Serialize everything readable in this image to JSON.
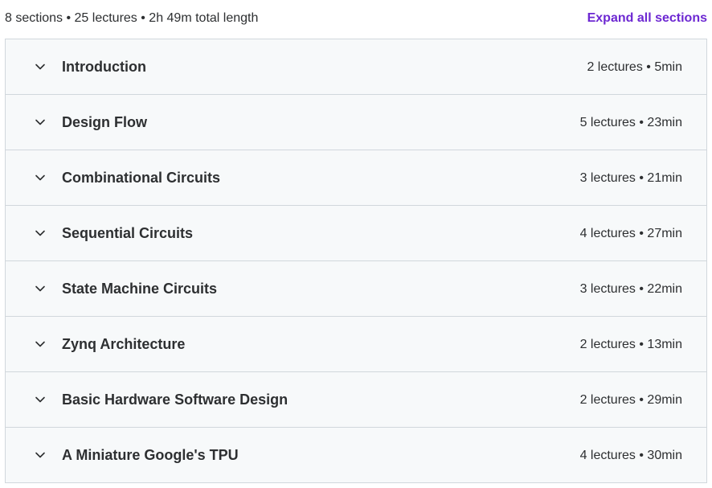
{
  "summary": {
    "text": "8 sections • 25 lectures • 2h 49m total length",
    "expand_all_label": "Expand all sections"
  },
  "sections": [
    {
      "title": "Introduction",
      "meta": "2 lectures • 5min"
    },
    {
      "title": "Design Flow",
      "meta": "5 lectures • 23min"
    },
    {
      "title": "Combinational Circuits",
      "meta": "3 lectures • 21min"
    },
    {
      "title": "Sequential Circuits",
      "meta": "4 lectures • 27min"
    },
    {
      "title": "State Machine Circuits",
      "meta": "3 lectures • 22min"
    },
    {
      "title": "Zynq Architecture",
      "meta": "2 lectures • 13min"
    },
    {
      "title": "Basic Hardware Software Design",
      "meta": "2 lectures • 29min"
    },
    {
      "title": "A Miniature Google's TPU",
      "meta": "4 lectures • 30min"
    }
  ],
  "icons": {
    "section_toggle": "chevron-down-icon"
  },
  "colors": {
    "accent": "#6d28d2",
    "row_background": "#f7f9fa",
    "border": "#d1d7dc",
    "text": "#2d2f31"
  }
}
